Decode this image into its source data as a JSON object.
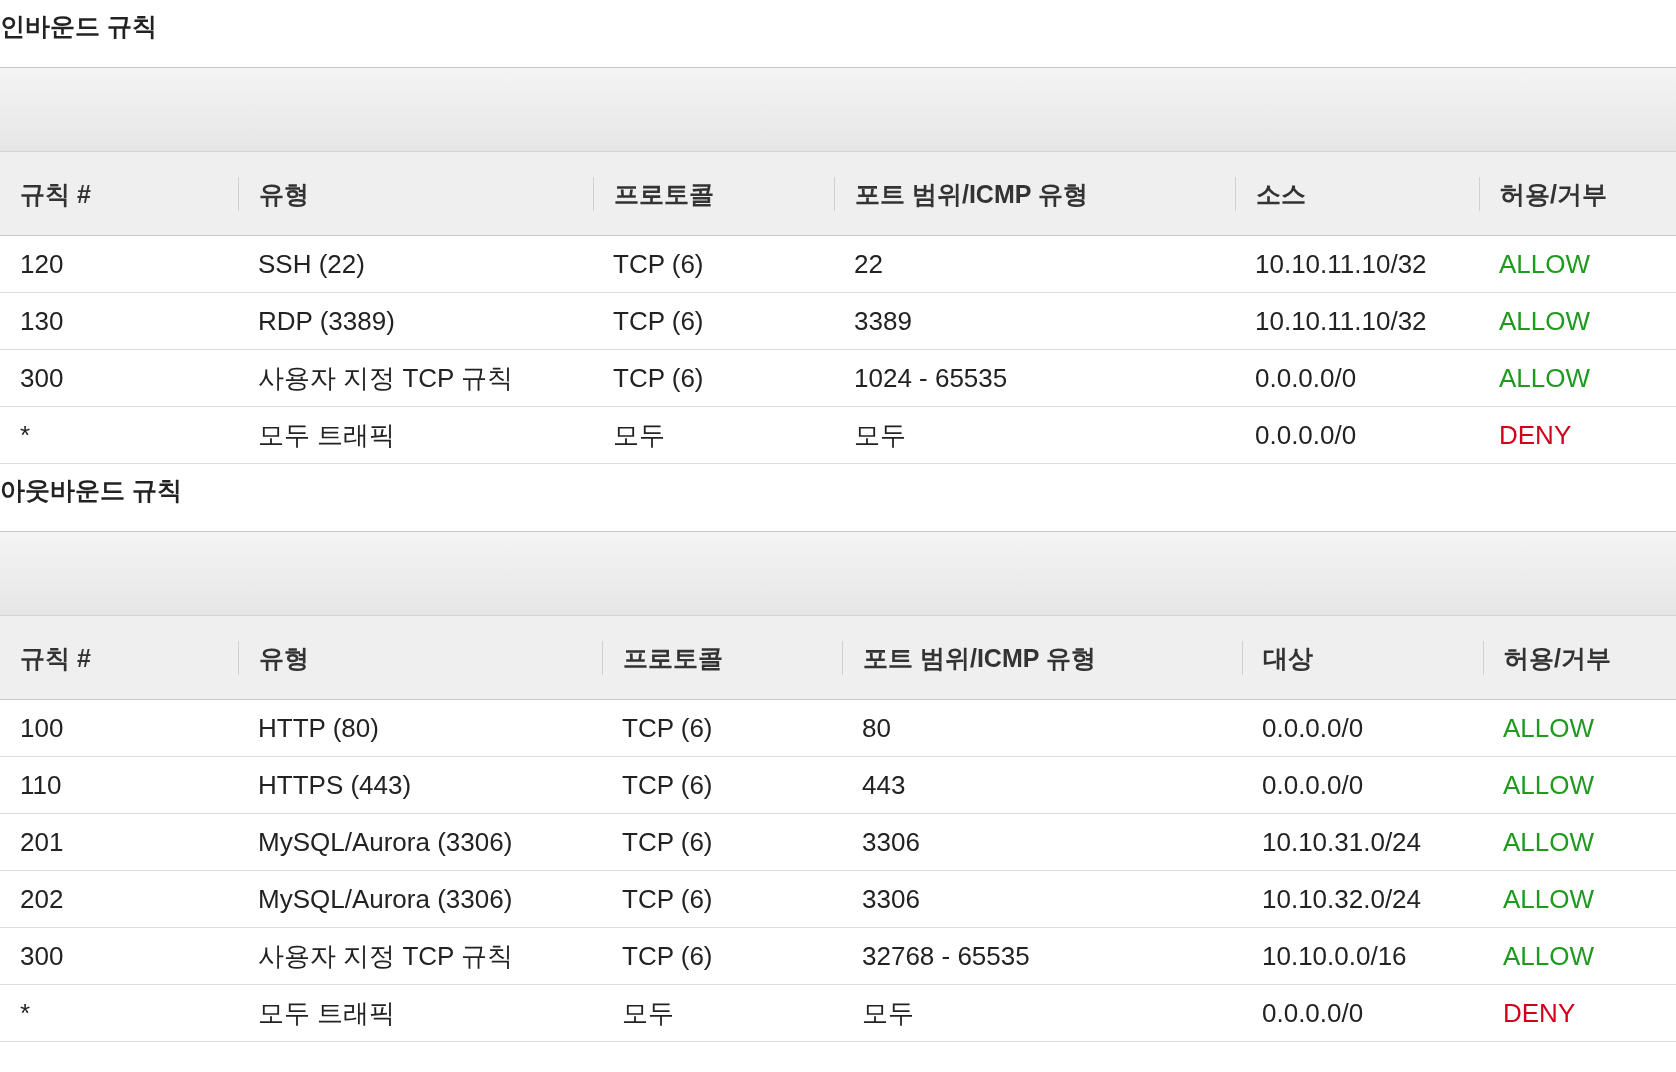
{
  "sections": [
    {
      "title": "인바운드 규칙",
      "columns": [
        "규칙 #",
        "유형",
        "프로토콜",
        "포트 범위/ICMP 유형",
        "소스",
        "허용/거부"
      ],
      "rows": [
        {
          "cells": [
            "120",
            "SSH (22)",
            "TCP (6)",
            "22",
            "10.10.11.10/32",
            "ALLOW"
          ],
          "color": "#1f9a1f"
        },
        {
          "cells": [
            "130",
            "RDP (3389)",
            "TCP (6)",
            "3389",
            "10.10.11.10/32",
            "ALLOW"
          ],
          "color": "#1f9a1f"
        },
        {
          "cells": [
            "300",
            "사용자 지정 TCP 규칙",
            "TCP (6)",
            "1024 - 65535",
            "0.0.0.0/0",
            "ALLOW"
          ],
          "color": "#1f9a1f"
        },
        {
          "cells": [
            "*",
            "모두 트래픽",
            "모두",
            "모두",
            "0.0.0.0/0",
            "DENY"
          ],
          "color": "#d0021b"
        }
      ]
    },
    {
      "title": "아웃바운드 규칙",
      "columns": [
        "규칙 #",
        "유형",
        "프로토콜",
        "포트 범위/ICMP 유형",
        "대상",
        "허용/거부"
      ],
      "rows": [
        {
          "cells": [
            "100",
            "HTTP (80)",
            "TCP (6)",
            "80",
            "0.0.0.0/0",
            "ALLOW"
          ],
          "color": "#1f9a1f"
        },
        {
          "cells": [
            "110",
            "HTTPS (443)",
            "TCP (6)",
            "443",
            "0.0.0.0/0",
            "ALLOW"
          ],
          "color": "#1f9a1f"
        },
        {
          "cells": [
            "201",
            "MySQL/Aurora (3306)",
            "TCP (6)",
            "3306",
            "10.10.31.0/24",
            "ALLOW"
          ],
          "color": "#1f9a1f"
        },
        {
          "cells": [
            "202",
            "MySQL/Aurora (3306)",
            "TCP (6)",
            "3306",
            "10.10.32.0/24",
            "ALLOW"
          ],
          "color": "#1f9a1f"
        },
        {
          "cells": [
            "300",
            "사용자 지정 TCP 규칙",
            "TCP (6)",
            "32768 - 65535",
            "10.10.0.0/16",
            "ALLOW"
          ],
          "color": "#1f9a1f"
        },
        {
          "cells": [
            "*",
            "모두 트래픽",
            "모두",
            "모두",
            "0.0.0.0/0",
            "DENY"
          ],
          "color": "#d0021b"
        }
      ]
    }
  ]
}
